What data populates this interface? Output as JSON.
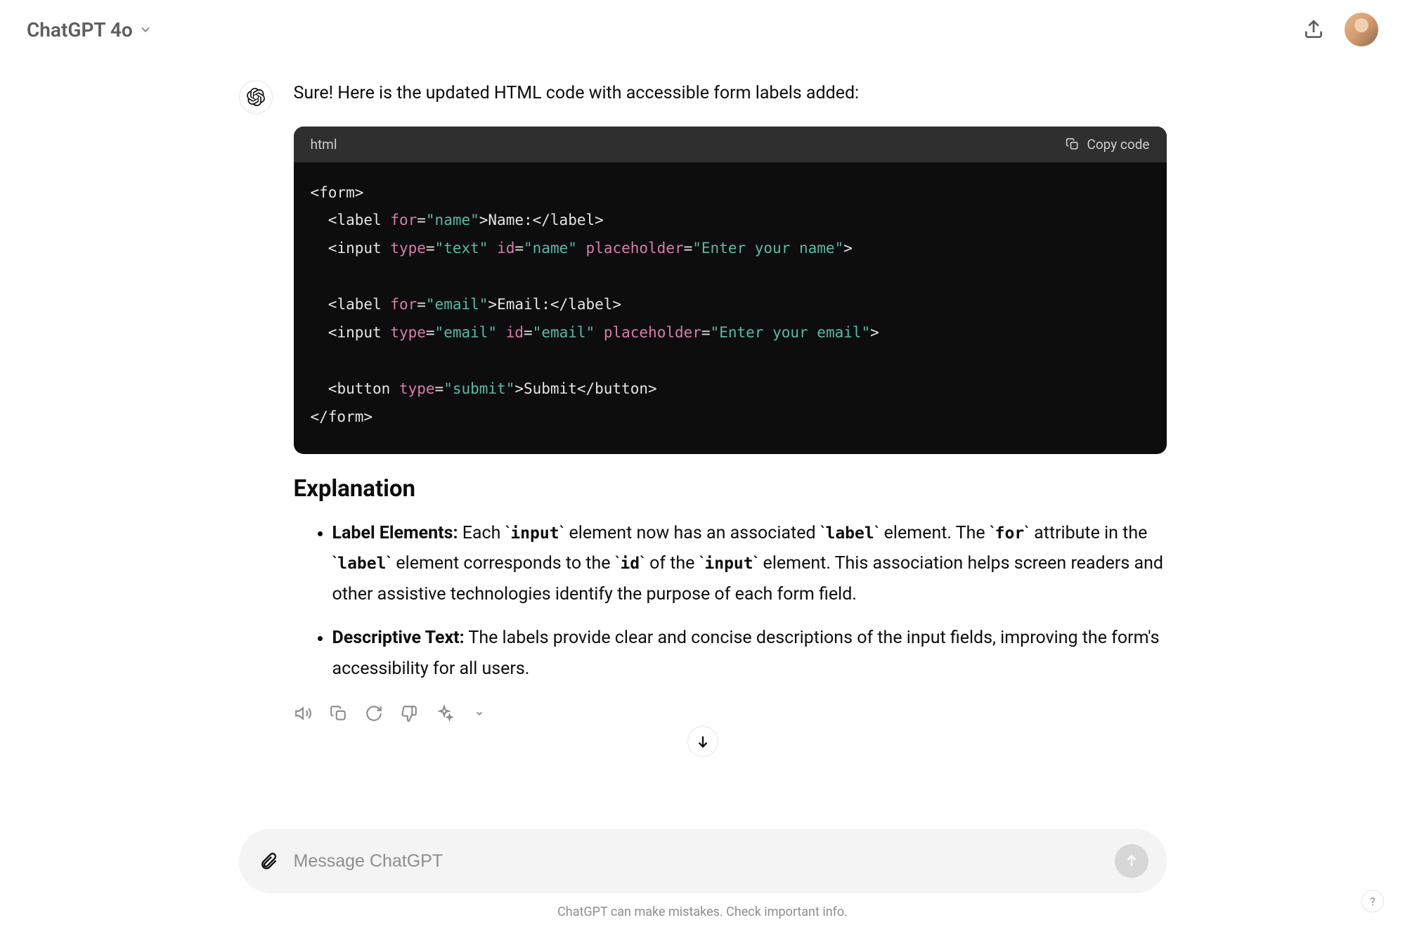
{
  "header": {
    "model_name": "ChatGPT 4o"
  },
  "message": {
    "intro": "Sure! Here is the updated HTML code with accessible form labels added:"
  },
  "code_block": {
    "language": "html",
    "copy_label": "Copy code",
    "tokens": [
      {
        "c": "tag",
        "t": "<form>"
      },
      {
        "c": "nl"
      },
      {
        "c": "ind",
        "t": "  "
      },
      {
        "c": "tag",
        "t": "<label "
      },
      {
        "c": "attr",
        "t": "for"
      },
      {
        "c": "tag",
        "t": "="
      },
      {
        "c": "val",
        "t": "\"name\""
      },
      {
        "c": "tag",
        "t": ">Name:</label>"
      },
      {
        "c": "nl"
      },
      {
        "c": "ind",
        "t": "  "
      },
      {
        "c": "tag",
        "t": "<input "
      },
      {
        "c": "attr",
        "t": "type"
      },
      {
        "c": "tag",
        "t": "="
      },
      {
        "c": "val",
        "t": "\"text\""
      },
      {
        "c": "tag",
        "t": " "
      },
      {
        "c": "attr",
        "t": "id"
      },
      {
        "c": "tag",
        "t": "="
      },
      {
        "c": "val",
        "t": "\"name\""
      },
      {
        "c": "tag",
        "t": " "
      },
      {
        "c": "attr",
        "t": "placeholder"
      },
      {
        "c": "tag",
        "t": "="
      },
      {
        "c": "val",
        "t": "\"Enter your name\""
      },
      {
        "c": "tag",
        "t": ">"
      },
      {
        "c": "nl"
      },
      {
        "c": "nl"
      },
      {
        "c": "ind",
        "t": "  "
      },
      {
        "c": "tag",
        "t": "<label "
      },
      {
        "c": "attr",
        "t": "for"
      },
      {
        "c": "tag",
        "t": "="
      },
      {
        "c": "val",
        "t": "\"email\""
      },
      {
        "c": "tag",
        "t": ">Email:</label>"
      },
      {
        "c": "nl"
      },
      {
        "c": "ind",
        "t": "  "
      },
      {
        "c": "tag",
        "t": "<input "
      },
      {
        "c": "attr",
        "t": "type"
      },
      {
        "c": "tag",
        "t": "="
      },
      {
        "c": "val",
        "t": "\"email\""
      },
      {
        "c": "tag",
        "t": " "
      },
      {
        "c": "attr",
        "t": "id"
      },
      {
        "c": "tag",
        "t": "="
      },
      {
        "c": "val",
        "t": "\"email\""
      },
      {
        "c": "tag",
        "t": " "
      },
      {
        "c": "attr",
        "t": "placeholder"
      },
      {
        "c": "tag",
        "t": "="
      },
      {
        "c": "val",
        "t": "\"Enter your email\""
      },
      {
        "c": "tag",
        "t": ">"
      },
      {
        "c": "nl"
      },
      {
        "c": "nl"
      },
      {
        "c": "ind",
        "t": "  "
      },
      {
        "c": "tag",
        "t": "<button "
      },
      {
        "c": "attr",
        "t": "type"
      },
      {
        "c": "tag",
        "t": "="
      },
      {
        "c": "val",
        "t": "\"submit\""
      },
      {
        "c": "tag",
        "t": ">Submit</button>"
      },
      {
        "c": "nl"
      },
      {
        "c": "tag",
        "t": "</form>"
      }
    ]
  },
  "explanation": {
    "heading": "Explanation",
    "items": [
      {
        "label": "Label Elements:",
        "frags": [
          {
            "k": "text",
            "t": " Each "
          },
          {
            "k": "code",
            "t": "input"
          },
          {
            "k": "text",
            "t": " element now has an associated "
          },
          {
            "k": "code",
            "t": "label"
          },
          {
            "k": "text",
            "t": " element. The "
          },
          {
            "k": "code",
            "t": "for"
          },
          {
            "k": "text",
            "t": " attribute in the "
          },
          {
            "k": "code",
            "t": "label"
          },
          {
            "k": "text",
            "t": " element corresponds to the "
          },
          {
            "k": "code",
            "t": "id"
          },
          {
            "k": "text",
            "t": " of the "
          },
          {
            "k": "code",
            "t": "input"
          },
          {
            "k": "text",
            "t": " element. This association helps screen readers and other assistive technologies identify the purpose of each form field."
          }
        ]
      },
      {
        "label": "Descriptive Text:",
        "frags": [
          {
            "k": "text",
            "t": " The labels provide clear and concise descriptions of the input fields, improving the form's accessibility for all users."
          }
        ]
      }
    ]
  },
  "composer": {
    "placeholder": "Message ChatGPT"
  },
  "footer": {
    "disclaimer": "ChatGPT can make mistakes. Check important info."
  },
  "help": "?"
}
